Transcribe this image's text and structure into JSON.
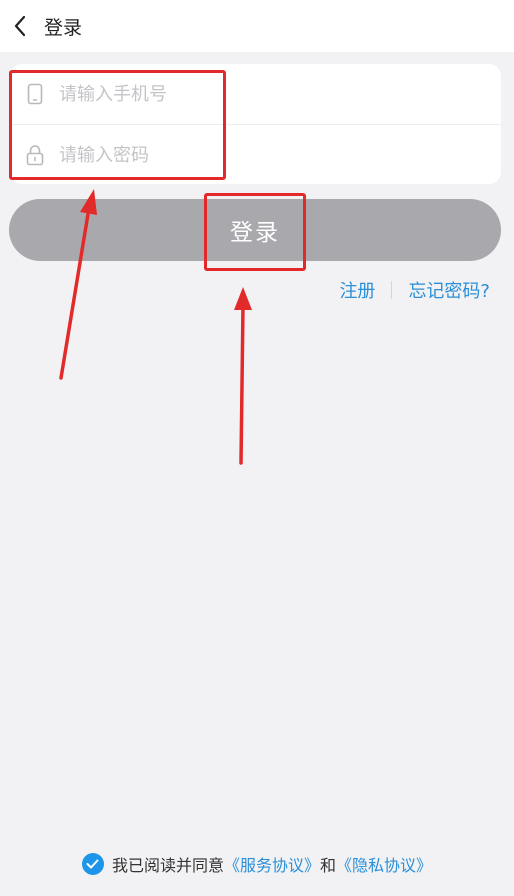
{
  "header": {
    "title": "登录",
    "back_icon": "chevron-left-icon"
  },
  "form": {
    "phone": {
      "placeholder": "请输入手机号",
      "value": "",
      "icon": "phone-icon"
    },
    "password": {
      "placeholder": "请输入密码",
      "value": "",
      "icon": "lock-icon"
    }
  },
  "login_button": {
    "label": "登录",
    "color": "#a9a9ad"
  },
  "links": {
    "register": "注册",
    "forgot_password": "忘记密码?"
  },
  "agreement": {
    "checked": true,
    "prefix": "我已阅读并同意",
    "service_link": "《服务协议》",
    "conjunction": "和",
    "privacy_link": "《隐私协议》"
  },
  "colors": {
    "accent": "#2a8fd8",
    "annotation": "#e32a2a",
    "background": "#f2f2f4"
  }
}
